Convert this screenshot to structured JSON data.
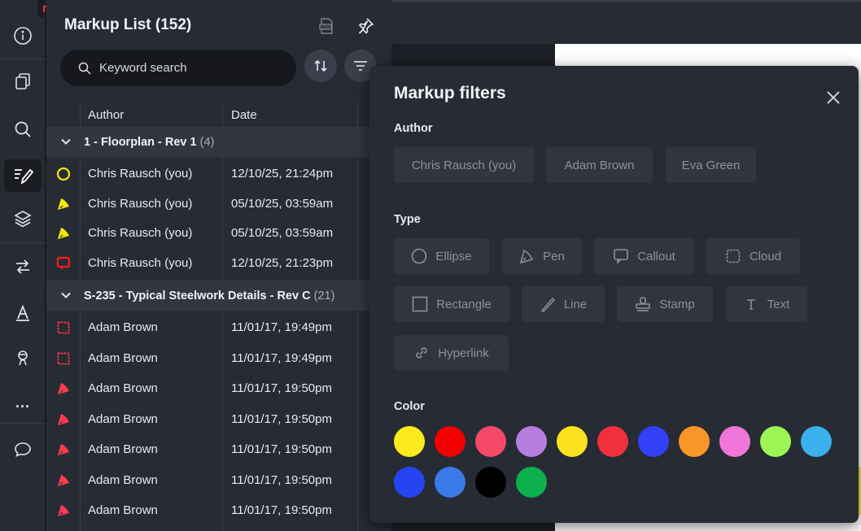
{
  "panel": {
    "title": "Markup List (152)",
    "search_placeholder": "Keyword search",
    "columns": {
      "author": "Author",
      "date": "Date"
    }
  },
  "groups": [
    {
      "name": "1 - Floorplan - Rev 1",
      "count": "(4)",
      "rows": [
        {
          "icon": "ellipse-icon",
          "color": "#f5e50f",
          "author": "Chris Rausch (you)",
          "date": "12/10/25, 21:24pm"
        },
        {
          "icon": "pen-icon",
          "color": "#f5e50f",
          "author": "Chris Rausch (you)",
          "date": "05/10/25, 03:59am"
        },
        {
          "icon": "pen-icon",
          "color": "#f5e50f",
          "author": "Chris Rausch (you)",
          "date": "05/10/25, 03:59am"
        },
        {
          "icon": "callout-icon",
          "color": "#ff1a1a",
          "author": "Chris Rausch (you)",
          "date": "12/10/25, 21:23pm"
        }
      ]
    },
    {
      "name": "S-235 - Typical Steelwork Details - Rev C",
      "count": "(21)",
      "rows": [
        {
          "icon": "cloud-icon",
          "color": "#ff3b4e",
          "author": "Adam Brown",
          "date": "11/01/17, 19:49pm"
        },
        {
          "icon": "cloud-icon",
          "color": "#ff3b4e",
          "author": "Adam Brown",
          "date": "11/01/17, 19:49pm"
        },
        {
          "icon": "pen-icon",
          "color": "#ff3b4e",
          "author": "Adam Brown",
          "date": "11/01/17, 19:50pm"
        },
        {
          "icon": "pen-icon",
          "color": "#ff3b4e",
          "author": "Adam Brown",
          "date": "11/01/17, 19:50pm"
        },
        {
          "icon": "pen-icon",
          "color": "#ff3b4e",
          "author": "Adam Brown",
          "date": "11/01/17, 19:50pm"
        },
        {
          "icon": "pen-icon",
          "color": "#ff3b4e",
          "author": "Adam Brown",
          "date": "11/01/17, 19:50pm"
        },
        {
          "icon": "pen-icon",
          "color": "#ff3b4e",
          "author": "Adam Brown",
          "date": "11/01/17, 19:50pm"
        }
      ]
    }
  ],
  "rail": {
    "items": [
      "info-icon",
      "pages-icon",
      "search-icon",
      "markup-icon",
      "layers-icon",
      "compare-icon",
      "text-style-icon",
      "user-icon",
      "more-icon",
      "comments-icon"
    ],
    "active": "markup-icon",
    "more_label": "..."
  },
  "filters": {
    "title": "Markup filters",
    "author_label": "Author",
    "authors": [
      "Chris Rausch (you)",
      "Adam Brown",
      "Eva Green"
    ],
    "type_label": "Type",
    "types": [
      "Ellipse",
      "Pen",
      "Callout",
      "Cloud",
      "Rectangle",
      "Line",
      "Stamp",
      "Text",
      "Hyperlink"
    ],
    "color_label": "Color",
    "colors": [
      "#fbeb1e",
      "#f40000",
      "#f5496a",
      "#b77ee0",
      "#fbe11e",
      "#f0303d",
      "#3241f7",
      "#fa9628",
      "#f077d9",
      "#9bf555",
      "#3ab0ec",
      "#2645f2",
      "#3a7ae8",
      "#000000",
      "#0cb04c"
    ]
  }
}
